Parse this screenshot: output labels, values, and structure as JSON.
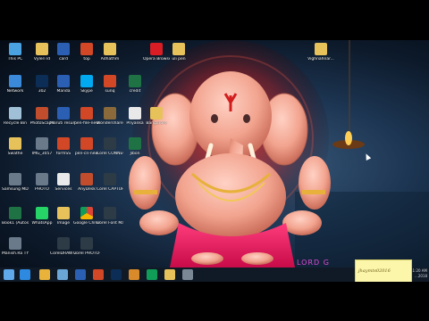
{
  "desktop_icons": [
    {
      "id": "this-pc",
      "label": "This PC",
      "icon": "pc-icon",
      "kind": "pc"
    },
    {
      "id": "vyleri",
      "label": "Vyleri ld",
      "icon": "folder-icon",
      "kind": "folder"
    },
    {
      "id": "card",
      "label": "card",
      "icon": "word-icon",
      "kind": "word"
    },
    {
      "id": "top",
      "label": "top",
      "icon": "ppt-icon",
      "kind": "ppt"
    },
    {
      "id": "adhathm",
      "label": "Adhathm",
      "icon": "folder-icon",
      "kind": "folder"
    },
    {
      "id": "opera",
      "label": "Opera Browser",
      "icon": "opera-icon",
      "kind": "opera"
    },
    {
      "id": "uli-pen",
      "label": "uli pen",
      "icon": "folder-icon",
      "kind": "folder"
    },
    {
      "id": "vighnah",
      "label": "Vighnahnar...",
      "icon": "folder-icon",
      "kind": "folder"
    },
    {
      "id": "network",
      "label": "Network",
      "icon": "network-icon",
      "kind": "net"
    },
    {
      "id": "302",
      "label": "302",
      "icon": "photoshop-icon",
      "kind": "ps"
    },
    {
      "id": "manda",
      "label": "Manda",
      "icon": "word-icon",
      "kind": "word"
    },
    {
      "id": "skype",
      "label": "Skype",
      "icon": "skype-icon",
      "kind": "skype"
    },
    {
      "id": "sunq",
      "label": "sunq",
      "icon": "ppt-icon",
      "kind": "ppt"
    },
    {
      "id": "credit",
      "label": "credit",
      "icon": "excel-icon",
      "kind": "excel"
    },
    {
      "id": "recycle",
      "label": "Recycle Bin",
      "icon": "recycle-bin-icon",
      "kind": "bin"
    },
    {
      "id": "photoscape",
      "label": "PhotoScape",
      "icon": "photoscape-icon",
      "kind": "app"
    },
    {
      "id": "maruti",
      "label": "Maruti resume",
      "icon": "word-icon",
      "kind": "word"
    },
    {
      "id": "pen-file",
      "label": "pen-file-new",
      "icon": "ppt-icon",
      "kind": "ppt"
    },
    {
      "id": "wondershare",
      "label": "Wondershare Filmora",
      "icon": "filmora-icon",
      "kind": "tool"
    },
    {
      "id": "priyanka",
      "label": "Priyanka",
      "icon": "document-icon",
      "kind": "doc"
    },
    {
      "id": "bangarore",
      "label": "Bangarore",
      "icon": "folder-icon",
      "kind": "folder"
    },
    {
      "id": "swathe",
      "label": "Swathe",
      "icon": "folder-icon",
      "kind": "folder"
    },
    {
      "id": "img3057",
      "label": "IMG_3057",
      "icon": "image-icon",
      "kind": "img"
    },
    {
      "id": "formss",
      "label": "formSS",
      "icon": "ppt-icon",
      "kind": "ppt"
    },
    {
      "id": "pen-cn",
      "label": "pen-cn-new",
      "icon": "ppt-icon",
      "kind": "ppt"
    },
    {
      "id": "corel-connect",
      "label": "Corel CONNECT...",
      "icon": "corel-icon",
      "kind": "corel"
    },
    {
      "id": "jibon",
      "label": "Jibon",
      "icon": "app-icon",
      "kind": "excel"
    },
    {
      "id": "samsung",
      "label": "Samsung MDS'S 20...",
      "icon": "tool-icon",
      "kind": "img"
    },
    {
      "id": "photo",
      "label": "PHOTO",
      "icon": "image-icon",
      "kind": "img"
    },
    {
      "id": "services",
      "label": "Services",
      "icon": "document-icon",
      "kind": "doc"
    },
    {
      "id": "anydesk",
      "label": "AnyDesk",
      "icon": "anydesk-icon",
      "kind": "app"
    },
    {
      "id": "corel-capture",
      "label": "Corel CAPTURE ...",
      "icon": "corel-icon",
      "kind": "corel"
    },
    {
      "id": "book1",
      "label": "Book1 (Autosaved)",
      "icon": "excel-icon",
      "kind": "excel"
    },
    {
      "id": "whatsapp",
      "label": "WhatsApp",
      "icon": "whatsapp-icon",
      "kind": "whatsapp"
    },
    {
      "id": "image",
      "label": "Image",
      "icon": "folder-icon",
      "kind": "folder"
    },
    {
      "id": "chrome",
      "label": "Google Chrome",
      "icon": "chrome-icon",
      "kind": "chrome"
    },
    {
      "id": "corel-font",
      "label": "Corel Font Manager 2...",
      "icon": "corel-icon",
      "kind": "corel"
    },
    {
      "id": "manish",
      "label": "Manish.Ra TYPING",
      "icon": "image-icon",
      "kind": "img"
    },
    {
      "id": "coreldraw",
      "label": "CorelDRAW 2018 (64-Bit)",
      "icon": "coreldraw-icon",
      "kind": "corel"
    },
    {
      "id": "corel-photo",
      "label": "Corel PHOTO-P...",
      "icon": "corel-photo-icon",
      "kind": "corel"
    }
  ],
  "taskbar": {
    "items": [
      {
        "id": "start",
        "icon": "windows-start-icon",
        "color": "#5fa8ea"
      },
      {
        "id": "ie",
        "icon": "internet-explorer-icon",
        "color": "#2d8ae0"
      },
      {
        "id": "explorer",
        "icon": "file-explorer-icon",
        "color": "#e9b33b"
      },
      {
        "id": "store",
        "icon": "store-icon",
        "color": "#6aa6d6"
      },
      {
        "id": "word",
        "icon": "word-icon",
        "color": "#2b5fb3"
      },
      {
        "id": "ppt",
        "icon": "ppt-icon",
        "color": "#d24726"
      },
      {
        "id": "ps",
        "icon": "photoshop-icon",
        "color": "#0c2d55"
      },
      {
        "id": "paint",
        "icon": "paint-icon",
        "color": "#d98b2b"
      },
      {
        "id": "chrome",
        "icon": "chrome-icon",
        "color": "#0f9d58"
      },
      {
        "id": "folder",
        "icon": "folder-icon",
        "color": "#e7c25a"
      },
      {
        "id": "settings",
        "icon": "settings-icon",
        "color": "#7a8896"
      }
    ],
    "clock_time": "11:20 AM",
    "clock_date": "...2018"
  },
  "sticky_note": {
    "text": "jhaymts02016"
  },
  "wallpaper_caption": "LORD G",
  "colors": {
    "taskbar": "#101a26",
    "sticky": "#fbf6a9",
    "caption": "#e24bd7"
  }
}
